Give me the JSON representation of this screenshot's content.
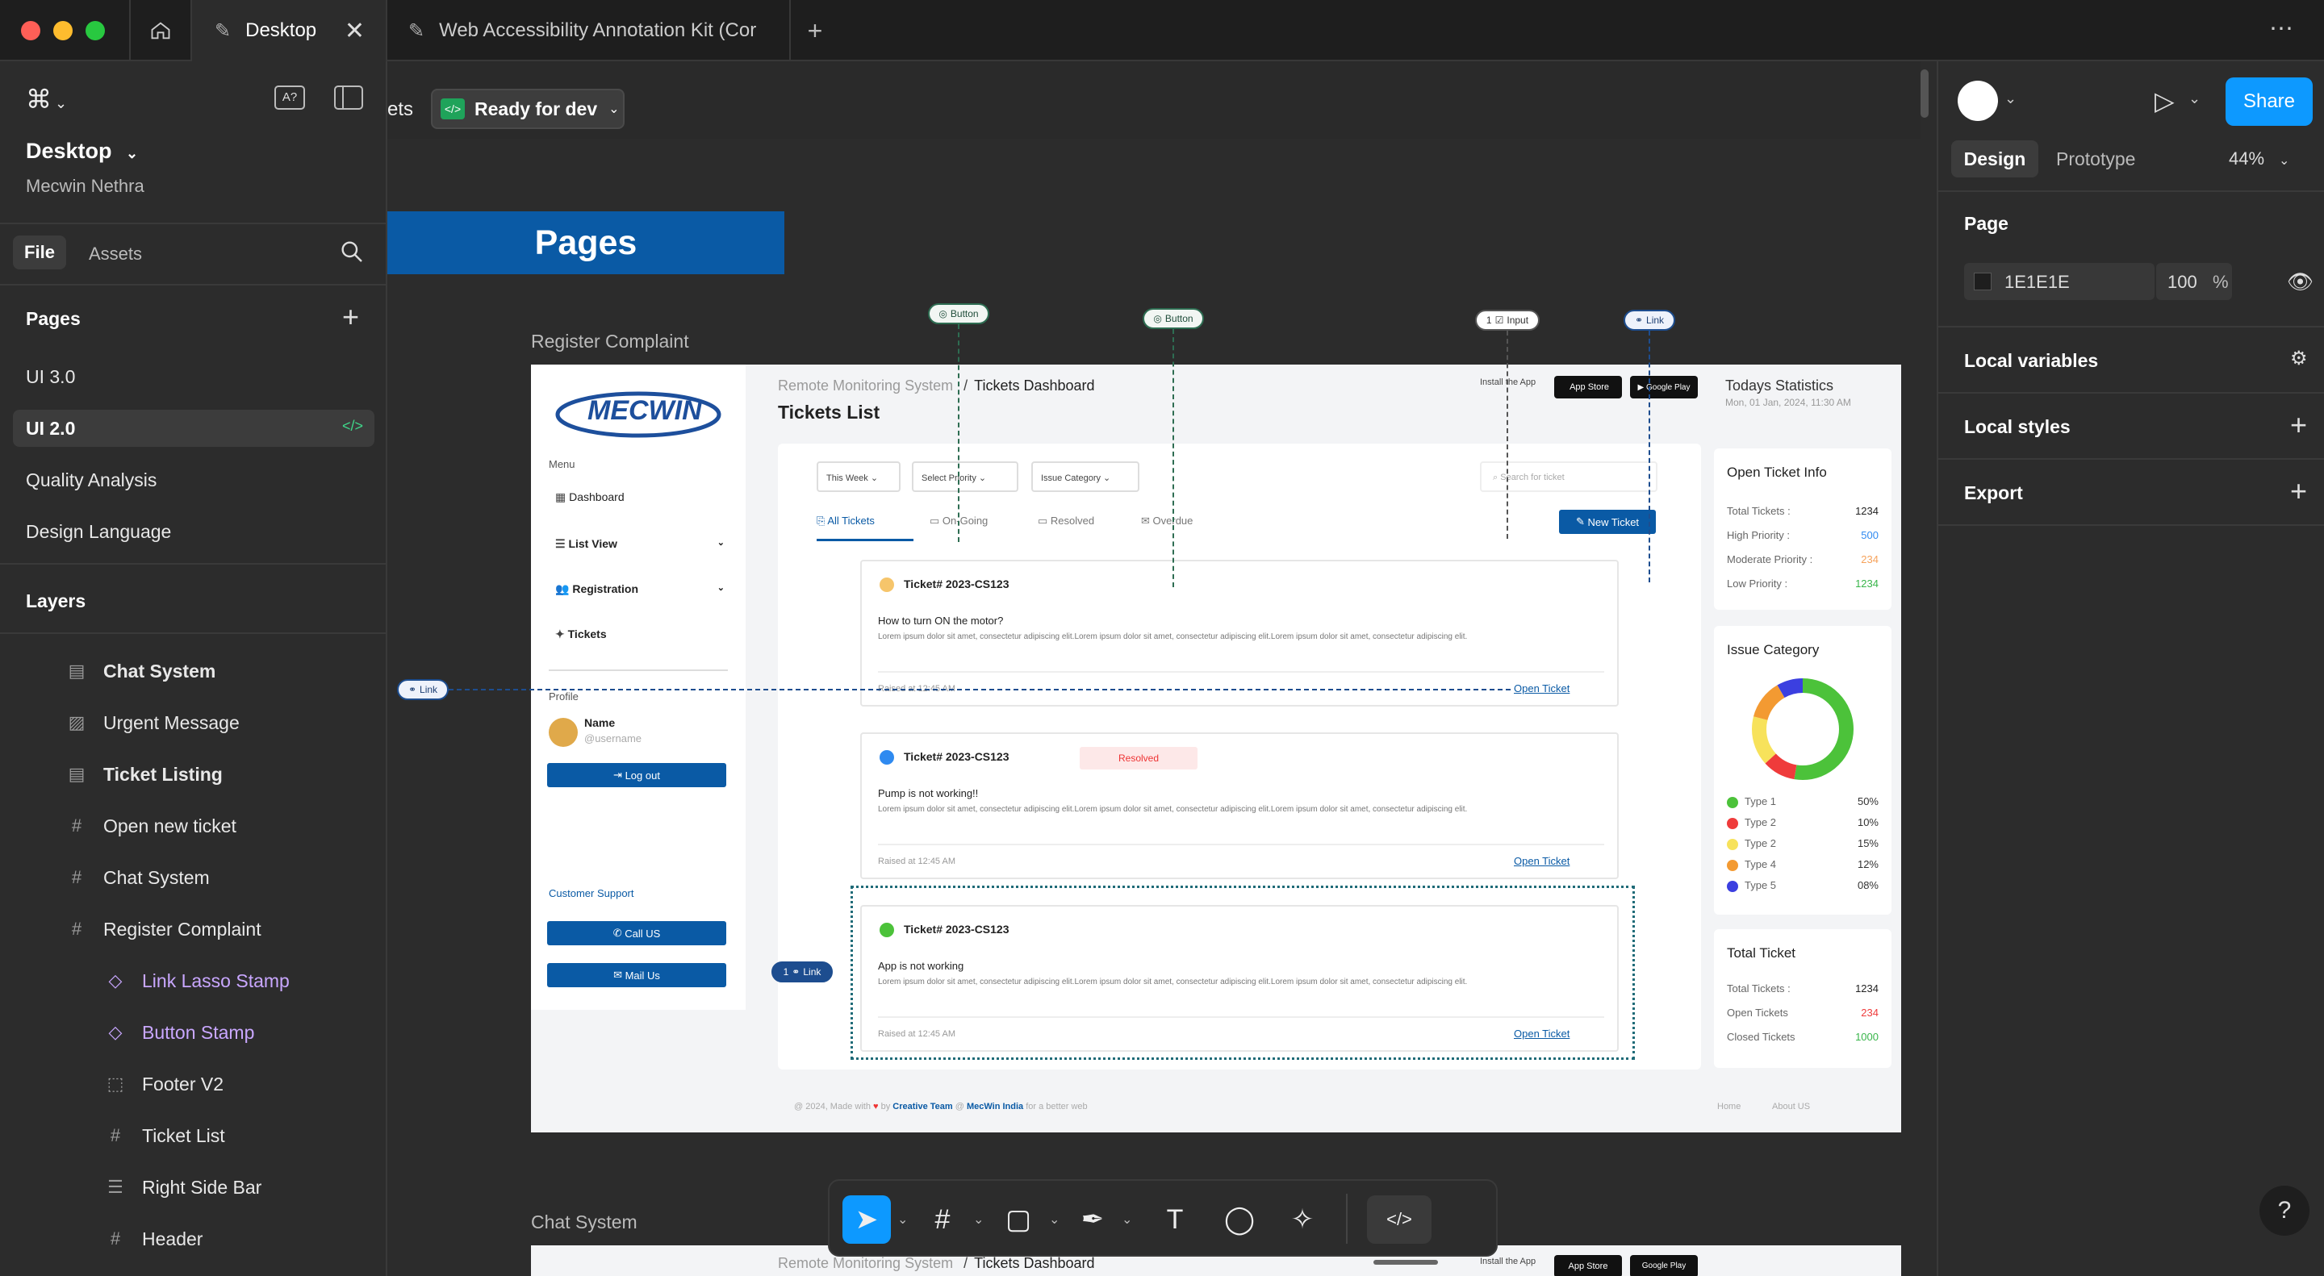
{
  "app": {
    "tabs": [
      {
        "label": "Desktop"
      },
      {
        "label": "Web Accessibility Annotation Kit (Cor"
      }
    ]
  },
  "canvas_top": {
    "partial_label": "ets",
    "ready_label": "Ready for dev",
    "pages_banner": "Pages"
  },
  "left": {
    "file_name": "Desktop",
    "owner": "Mecwin Nethra",
    "tab_file": "File",
    "tab_assets": "Assets",
    "pages_title": "Pages",
    "pages": [
      "UI 3.0",
      "UI 2.0",
      "Quality Analysis",
      "Design Language"
    ],
    "layers_title": "Layers",
    "layers": [
      {
        "label": "Chat System",
        "icon": "section-icon"
      },
      {
        "label": "Urgent Message",
        "icon": "image-icon"
      },
      {
        "label": "Ticket Listing",
        "icon": "section-icon"
      },
      {
        "label": "Open new ticket",
        "icon": "frame-icon"
      },
      {
        "label": "Chat System",
        "icon": "frame-icon"
      },
      {
        "label": "Register Complaint",
        "icon": "frame-icon"
      },
      {
        "label": "Link Lasso Stamp",
        "icon": "component-icon"
      },
      {
        "label": "Button Stamp",
        "icon": "component-icon"
      },
      {
        "label": "Footer V2",
        "icon": "dashed-frame-icon"
      },
      {
        "label": "Ticket List",
        "icon": "frame-icon"
      },
      {
        "label": "Right Side Bar",
        "icon": "layout-icon"
      },
      {
        "label": "Header",
        "icon": "frame-icon"
      }
    ]
  },
  "right": {
    "share": "Share",
    "tab_design": "Design",
    "tab_prototype": "Prototype",
    "zoom": "44%",
    "page_title": "Page",
    "page_color": "1E1E1E",
    "page_opacity": "100",
    "percent": "%",
    "local_variables": "Local variables",
    "local_styles": "Local styles",
    "export": "Export"
  },
  "frame": {
    "label": "Register Complaint",
    "label2": "Chat System",
    "logo": "MECWIN",
    "breadcrumb_1": "Remote Monitoring System",
    "breadcrumb_sep": "/",
    "breadcrumb_2": "Tickets Dashboard",
    "page_title": "Tickets List",
    "install": "Install the App",
    "app_store": "App Store",
    "google_play": "Google Play",
    "stats_title": "Todays Statistics",
    "stats_date": "Mon, 01 Jan, 2024, 11:30 AM",
    "menu_label": "Menu",
    "menu": [
      "Dashboard",
      "List View",
      "Registration",
      "Tickets"
    ],
    "profile_label": "Profile",
    "profile_name": "Name",
    "profile_user": "@username",
    "logout": "Log out",
    "support_label": "Customer Support",
    "call": "Call US",
    "mail": "Mail Us",
    "filters": [
      "This Week",
      "Select Priority",
      "Issue Category"
    ],
    "search_placeholder": "Search for ticket",
    "tabs": [
      "All Tickets",
      "On-Going",
      "Resolved",
      "Overdue"
    ],
    "new_ticket": "New Ticket",
    "tickets": [
      {
        "id": "Ticket# 2023-CS123",
        "title": "How to turn ON the motor?",
        "body": "Lorem ipsum dolor sit amet, consectetur adipiscing elit.Lorem ipsum dolor sit amet, consectetur adipiscing elit.Lorem ipsum dolor sit amet, consectetur adipiscing elit.",
        "raised": "Raised at 12:45 AM",
        "link": "Open Ticket",
        "dot": "#f6c56b",
        "badge": ""
      },
      {
        "id": "Ticket# 2023-CS123",
        "title": "Pump is not working!!",
        "body": "Lorem ipsum dolor sit amet, consectetur adipiscing elit.Lorem ipsum dolor sit amet, consectetur adipiscing elit.Lorem ipsum dolor sit amet, consectetur adipiscing elit.",
        "raised": "Raised at 12:45 AM",
        "link": "Open Ticket",
        "dot": "#2f8af0",
        "badge": "Resolved"
      },
      {
        "id": "Ticket# 2023-CS123",
        "title": "App is not working",
        "body": "Lorem ipsum dolor sit amet, consectetur adipiscing elit.Lorem ipsum dolor sit amet, consectetur adipiscing elit.Lorem ipsum dolor sit amet, consectetur adipiscing elit.",
        "raised": "Raised at 12:45 AM",
        "link": "Open Ticket",
        "dot": "#4cc23a",
        "badge": ""
      }
    ],
    "open_info": {
      "title": "Open Ticket Info",
      "rows": [
        {
          "label": "Total Tickets :",
          "value": "1234",
          "color": "#222"
        },
        {
          "label": "High Priority :",
          "value": "500",
          "color": "#2f8af0"
        },
        {
          "label": "Moderate Priority :",
          "value": "234",
          "color": "#f6a25b"
        },
        {
          "label": "Low Priority :",
          "value": "1234",
          "color": "#38b54a"
        }
      ]
    },
    "issue": {
      "title": "Issue Category",
      "rows": [
        {
          "label": "Type 1",
          "value": "50%",
          "color": "#4cc23a"
        },
        {
          "label": "Type 2",
          "value": "10%",
          "color": "#ef3b3b"
        },
        {
          "label": "Type 2",
          "value": "15%",
          "color": "#f7e25b"
        },
        {
          "label": "Type 4",
          "value": "12%",
          "color": "#f39a32"
        },
        {
          "label": "Type 5",
          "value": "08%",
          "color": "#3b3fe0"
        }
      ]
    },
    "total": {
      "title": "Total Ticket",
      "rows": [
        {
          "label": "Total Tickets :",
          "value": "1234",
          "color": "#222"
        },
        {
          "label": "Open Tickets",
          "value": "234",
          "color": "#ef3b3b"
        },
        {
          "label": "Closed Tickets",
          "value": "1000",
          "color": "#38b54a"
        }
      ]
    },
    "footer": {
      "pre": "@ 2024, Made with",
      "by": "by",
      "team": "Creative Team",
      "at": "@",
      "company": "MecWin India",
      "post": "for a better web",
      "home": "Home",
      "about": "About US"
    }
  },
  "annotations": {
    "button": "Button",
    "input": "Input",
    "link": "Link",
    "one": "1"
  }
}
